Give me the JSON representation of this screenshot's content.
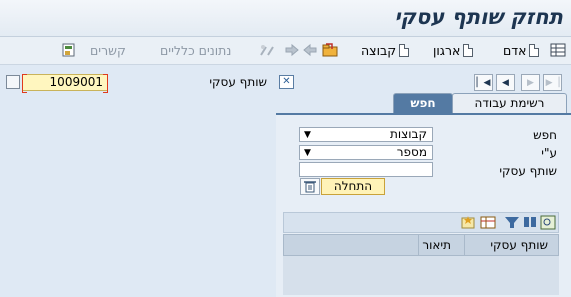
{
  "window": {
    "title": "תחזק שותף עסקי"
  },
  "toolbar": {
    "person": "אדם",
    "organization": "ארגון",
    "group": "קבוצה",
    "general_data": "נתונים כלליים",
    "relationships": "קשרים",
    "icons": [
      "person-doc-icon",
      "organization-doc-icon",
      "group-doc-icon",
      "open-folder-icon",
      "back-arrow-icon",
      "forward-arrow-icon",
      "switch-icon",
      "save-icon",
      "grid-icon"
    ]
  },
  "header": {
    "bp_label": "שותף עסקי",
    "bp_value": "1009001"
  },
  "locator": {
    "tabs": {
      "worklist": "רשימת עבודה",
      "search": "חפש"
    },
    "search_label": "חפש",
    "search_value": "קבוצות",
    "by_label": "ע\"י",
    "by_value": "מספר",
    "bp_field_label": "שותף עסקי",
    "bp_field_value": "",
    "start_button": "התחלה",
    "results": {
      "columns": [
        "שותף עסקי",
        "תיאור"
      ],
      "rows": []
    }
  }
}
